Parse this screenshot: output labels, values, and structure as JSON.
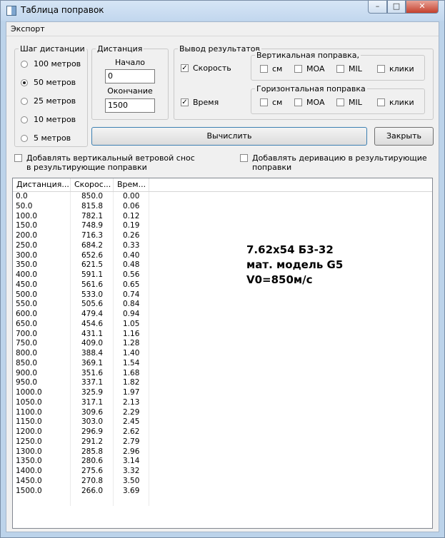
{
  "window": {
    "title": "Таблица поправок",
    "min_icon": "minimize-icon",
    "max_icon": "maximize-icon",
    "close_icon": "close-icon"
  },
  "menu": {
    "export": "Экспорт"
  },
  "step_group": {
    "title": "Шаг дистанции",
    "options": [
      "100 метров",
      "50 метров",
      "25 метров",
      "10 метров",
      "5 метров"
    ],
    "selected": "50 метров"
  },
  "distance_group": {
    "title": "Дистанция",
    "start_label": "Начало",
    "start_value": "0",
    "end_label": "Окончание",
    "end_value": "1500"
  },
  "output_group": {
    "title": "Вывод результатов",
    "speed_label": "Скорость",
    "speed_checked": true,
    "time_label": "Время",
    "time_checked": true,
    "vertical": {
      "title": "Вертикальная поправка,",
      "units": [
        "см",
        "MOA",
        "MIL",
        "клики"
      ]
    },
    "horizontal": {
      "title": "Горизонтальная поправка",
      "units": [
        "см",
        "MOA",
        "MIL",
        "клики"
      ]
    }
  },
  "buttons": {
    "calculate": "Вычислить",
    "close": "Закрыть"
  },
  "options": {
    "wind_drift": "Добавлять вертикальный ветровой снос в результирующие поправки",
    "derivation": "Добавлять деривацию в результирующие поправки"
  },
  "table": {
    "headers": [
      "Дистанция...",
      "Скорос...",
      "Врем..."
    ],
    "rows": [
      [
        "0.0",
        "850.0",
        "0.00"
      ],
      [
        "50.0",
        "815.8",
        "0.06"
      ],
      [
        "100.0",
        "782.1",
        "0.12"
      ],
      [
        "150.0",
        "748.9",
        "0.19"
      ],
      [
        "200.0",
        "716.3",
        "0.26"
      ],
      [
        "250.0",
        "684.2",
        "0.33"
      ],
      [
        "300.0",
        "652.6",
        "0.40"
      ],
      [
        "350.0",
        "621.5",
        "0.48"
      ],
      [
        "400.0",
        "591.1",
        "0.56"
      ],
      [
        "450.0",
        "561.6",
        "0.65"
      ],
      [
        "500.0",
        "533.0",
        "0.74"
      ],
      [
        "550.0",
        "505.6",
        "0.84"
      ],
      [
        "600.0",
        "479.4",
        "0.94"
      ],
      [
        "650.0",
        "454.6",
        "1.05"
      ],
      [
        "700.0",
        "431.1",
        "1.16"
      ],
      [
        "750.0",
        "409.0",
        "1.28"
      ],
      [
        "800.0",
        "388.4",
        "1.40"
      ],
      [
        "850.0",
        "369.1",
        "1.54"
      ],
      [
        "900.0",
        "351.6",
        "1.68"
      ],
      [
        "950.0",
        "337.1",
        "1.82"
      ],
      [
        "1000.0",
        "325.9",
        "1.97"
      ],
      [
        "1050.0",
        "317.1",
        "2.13"
      ],
      [
        "1100.0",
        "309.6",
        "2.29"
      ],
      [
        "1150.0",
        "303.0",
        "2.45"
      ],
      [
        "1200.0",
        "296.9",
        "2.62"
      ],
      [
        "1250.0",
        "291.2",
        "2.79"
      ],
      [
        "1300.0",
        "285.8",
        "2.96"
      ],
      [
        "1350.0",
        "280.6",
        "3.14"
      ],
      [
        "1400.0",
        "275.6",
        "3.32"
      ],
      [
        "1450.0",
        "270.8",
        "3.50"
      ],
      [
        "1500.0",
        "266.0",
        "3.69"
      ]
    ]
  },
  "annotation": [
    "7.62x54 Б3-32",
    "мат. модель G5",
    "V0=850м/с"
  ]
}
